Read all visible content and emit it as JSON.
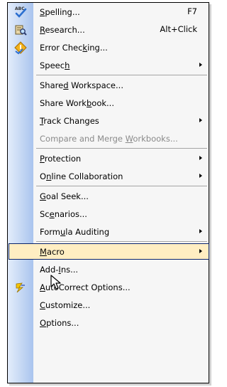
{
  "menu": {
    "items": [
      {
        "label": "Spelling...",
        "mnemonic": "S",
        "shortcut": "F7",
        "icon": "spelling-abc-check-icon"
      },
      {
        "label": "Research...",
        "mnemonic": "R",
        "shortcut": "Alt+Click",
        "icon": "research-book-magnifier-icon"
      },
      {
        "label": "Error Checking...",
        "mnemonic": "k",
        "shortcut": "",
        "icon": "error-checking-diamond-icon"
      },
      {
        "label": "Speech",
        "mnemonic": "h",
        "submenu": true
      },
      {
        "label": "Shared Workspace...",
        "mnemonic": "d"
      },
      {
        "label": "Share Workbook...",
        "mnemonic": "b"
      },
      {
        "label": "Track Changes",
        "mnemonic": "T",
        "submenu": true
      },
      {
        "label": "Compare and Merge Workbooks...",
        "mnemonic": "W",
        "disabled": true
      },
      {
        "label": "Protection",
        "mnemonic": "P",
        "submenu": true
      },
      {
        "label": "Online Collaboration",
        "mnemonic": "n",
        "submenu": true
      },
      {
        "label": "Goal Seek...",
        "mnemonic": "G"
      },
      {
        "label": "Scenarios...",
        "mnemonic": "e"
      },
      {
        "label": "Formula Auditing",
        "mnemonic": "u",
        "submenu": true
      },
      {
        "label": "Macro",
        "mnemonic": "M",
        "submenu": true,
        "highlighted": true
      },
      {
        "label": "Add-Ins...",
        "mnemonic": "I"
      },
      {
        "label": "AutoCorrect Options...",
        "mnemonic": "A",
        "icon": "autocorrect-lightning-icon"
      },
      {
        "label": "Customize...",
        "mnemonic": "C"
      },
      {
        "label": "Options...",
        "mnemonic": "O"
      }
    ]
  },
  "colors": {
    "highlight_fill": "#ffeec2",
    "highlight_border": "#0a246a",
    "gutter": "#a9c4ee",
    "menu_bg": "#f6f6f6",
    "disabled_text": "#8a8a8a"
  },
  "cursor": "arrow-pointer-icon"
}
